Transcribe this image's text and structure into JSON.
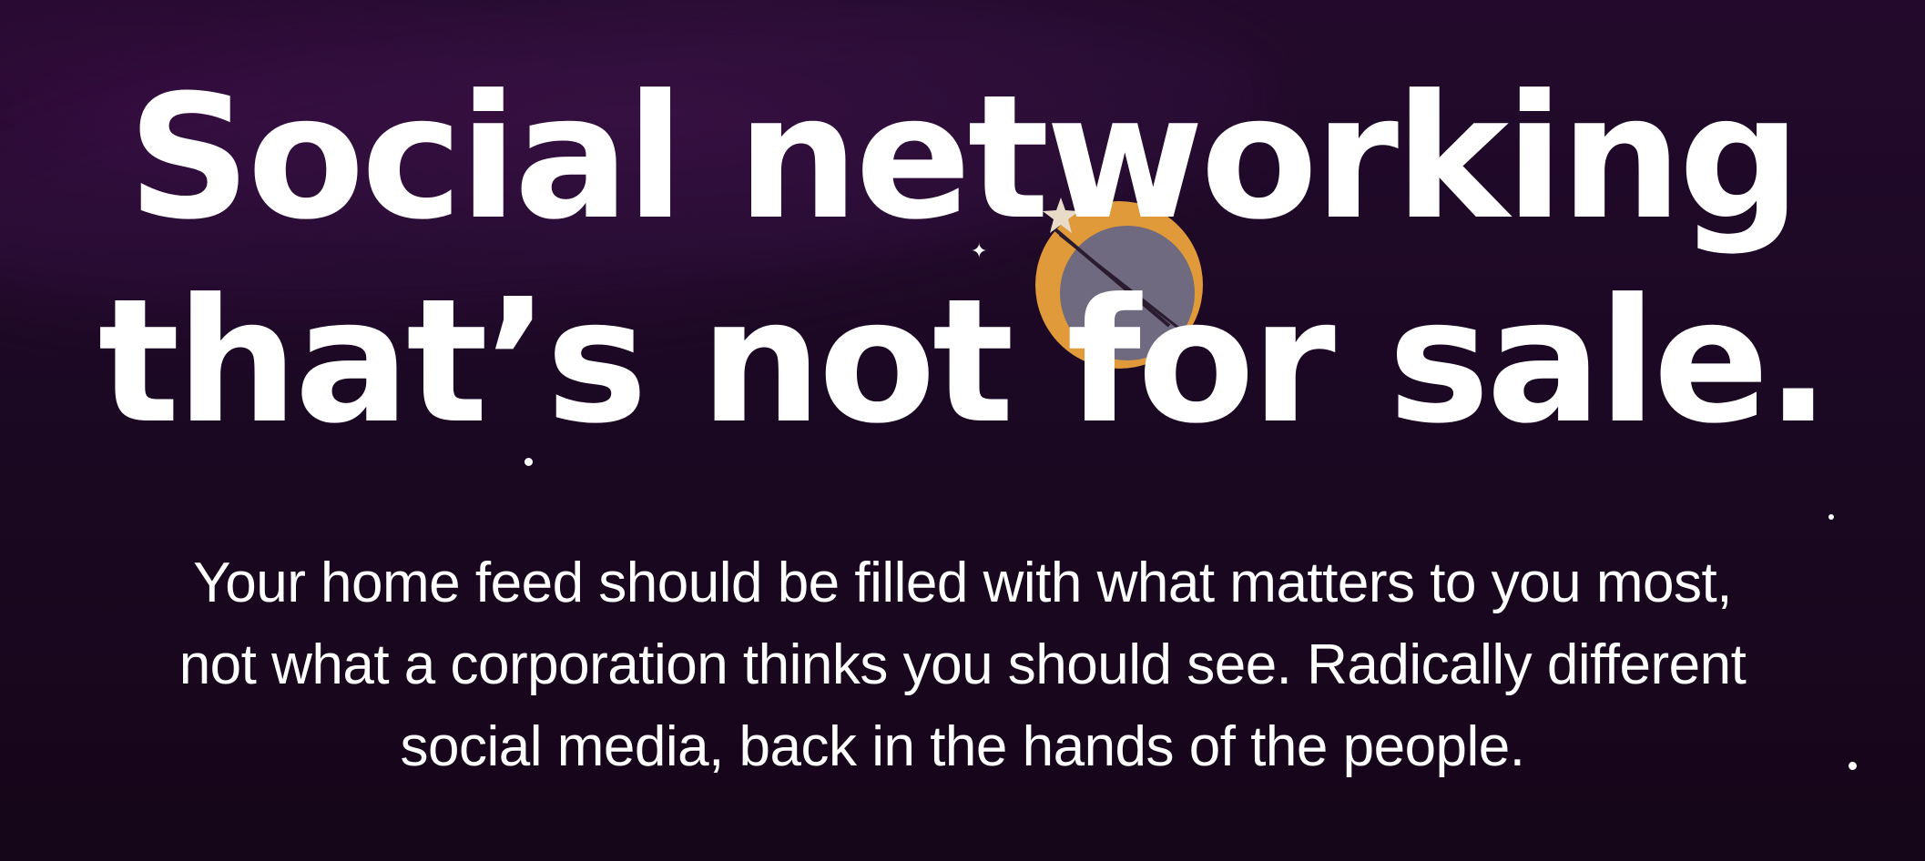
{
  "hero": {
    "headline_line1": "Social networking",
    "headline_line2": "that’s not for sale.",
    "subtext_line1": "Your home feed should be filled with what matters to you most,",
    "subtext_line2": "not what a corporation thinks you should see. Radically different",
    "subtext_line3": "social media, back in the hands of the people."
  },
  "colors": {
    "background": "#1a0722",
    "text": "#ffffff",
    "planet_ring": "#e09a3a",
    "planet_core": "#6f6a80"
  },
  "icons": {
    "planet": "planet-illustration",
    "sparkle": "sparkle-icon",
    "star": "star-icon"
  }
}
